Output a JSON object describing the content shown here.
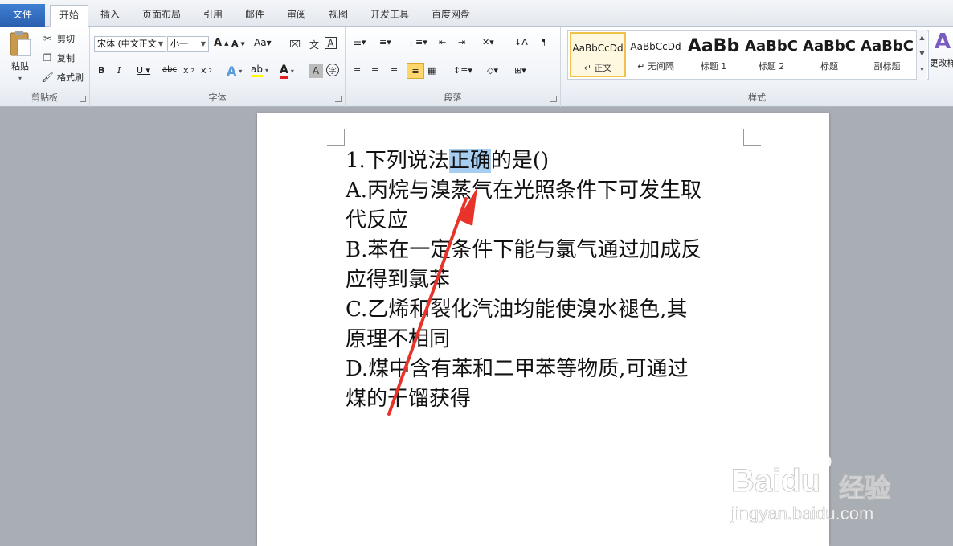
{
  "tabs": [
    "文件",
    "开始",
    "插入",
    "页面布局",
    "引用",
    "邮件",
    "审阅",
    "视图",
    "开发工具",
    "百度网盘"
  ],
  "clipboard": {
    "paste": "粘贴",
    "cut": "剪切",
    "copy": "复制",
    "format_painter": "格式刷",
    "label": "剪贴板"
  },
  "font": {
    "name": "宋体 (中文正文",
    "size": "小一",
    "label": "字体"
  },
  "paragraph": {
    "label": "段落"
  },
  "styles": {
    "label": "样式",
    "items": [
      {
        "preview": "AaBbCcDd",
        "name": "↵ 正文"
      },
      {
        "preview": "AaBbCcDd",
        "name": "↵ 无间隔"
      },
      {
        "preview": "AaBb",
        "name": "标题 1"
      },
      {
        "preview": "AaBbC",
        "name": "标题 2"
      },
      {
        "preview": "AaBbC",
        "name": "标题"
      },
      {
        "preview": "AaBbC",
        "name": "副标题"
      }
    ],
    "change": "更改样"
  },
  "document": {
    "line1_before": "1.下列说法",
    "line1_selected": "正确",
    "line1_after": "的是()",
    "lines": [
      "A.丙烷与溴蒸气在光照条件下可发生取",
      "代反应",
      "B.苯在一定条件下能与氯气通过加成反",
      "应得到氯苯",
      "C.乙烯和裂化汽油均能使溴水褪色,其",
      "原理不相同",
      "D.煤中含有苯和二甲苯等物质,可通过",
      "煤的干馏获得"
    ]
  },
  "watermark": {
    "brand": "Baidu",
    "brand_cn": "经验",
    "url": "jingyan.baidu.com"
  },
  "colors": {
    "file_tab": "#2a5fae",
    "selection": "#a7cdf0",
    "arrow": "#e8332a"
  }
}
